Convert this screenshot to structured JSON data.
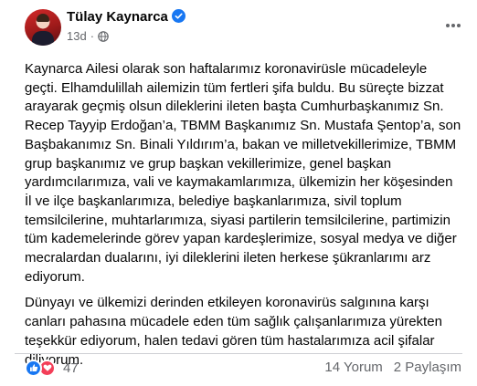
{
  "post": {
    "author": "Tülay Kaynarca",
    "timestamp": "13d",
    "separator": "·",
    "paragraphs": [
      "Kaynarca Ailesi olarak son haftalarımız koronavirüsle mücadeleyle geçti. Elhamdulillah ailemizin tüm fertleri şifa buldu. Bu süreçte bizzat arayarak geçmiş olsun dileklerini ileten başta Cumhurbaşkanımız Sn. Recep Tayyip Erdoğan’a, TBMM Başkanımız Sn. Mustafa Şentop’a, son Başbakanımız Sn. Binali Yıldırım’a, bakan ve milletvekillerimize, TBMM grup başkanımız ve grup başkan vekillerimize, genel başkan yardımcılarımıza, vali ve kaymakamlarımıza, ülkemizin her köşesinden İl ve ilçe başkanlarımıza, belediye başkanlarımıza, sivil toplum temsilcilerine, muhtarlarımıza, siyasi partilerin temsilcilerine, partimizin tüm kademelerinde görev yapan kardeşlerimize, sosyal medya ve diğer mecralardan dualarını, iyi dileklerini ileten herkese şükranlarımı arz ediyorum.",
      "Dünyayı ve ülkemizi derinden etkileyen koronavirüs salgınına karşı canları pahasına mücadele eden tüm sağlık çalışanlarımıza yürekten teşekkür ediyorum, halen tedavi gören tüm hastalarımıza acil şifalar diliyorum."
    ]
  },
  "engagement": {
    "reaction_count": "47",
    "comments": "14 Yorum",
    "shares": "2 Paylaşım"
  },
  "icons": {
    "verified": "verified-badge-icon",
    "privacy": "globe-icon",
    "more": "more-options-icon",
    "like": "like-reaction-icon",
    "love": "love-reaction-icon"
  },
  "colors": {
    "accent": "#1877f2",
    "love": "#f33e58",
    "secondary_text": "#65676b",
    "divider": "#ced0d4"
  }
}
